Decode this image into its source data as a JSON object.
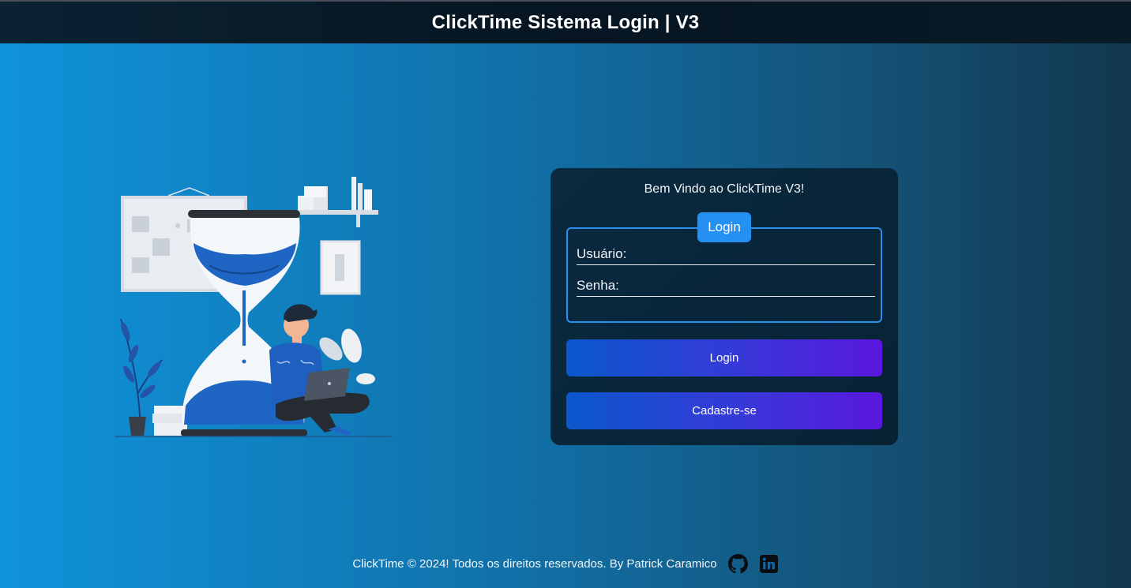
{
  "header": {
    "title": "ClickTime Sistema Login | V3"
  },
  "card": {
    "welcome": "Bem Vindo ao ClickTime V3!",
    "legend": "Login",
    "username_label": "Usuário:",
    "password_label": "Senha:",
    "login_button": "Login",
    "register_button": "Cadastre-se"
  },
  "footer": {
    "text": "ClickTime © 2024! Todos os direitos reservados. By Patrick Caramico",
    "icons": [
      "github-icon",
      "linkedin-icon"
    ]
  },
  "colors": {
    "accent": "#2390f2",
    "button_start": "#0b58cc",
    "button_end": "#5a17dd",
    "card_bg": "#0a2a40"
  }
}
